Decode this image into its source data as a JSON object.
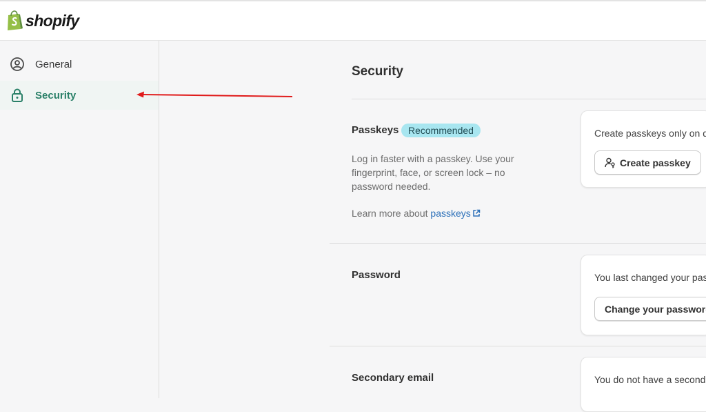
{
  "brand": {
    "name": "shopify"
  },
  "sidebar": {
    "items": [
      {
        "label": "General",
        "icon": "user-circle-icon",
        "active": false
      },
      {
        "label": "Security",
        "icon": "lock-icon",
        "active": true
      }
    ]
  },
  "main": {
    "title": "Security",
    "passkeys": {
      "title": "Passkeys",
      "badge": "Recommended",
      "description": "Log in faster with a passkey. Use your fingerprint, face, or screen lock – no password needed.",
      "learn_prefix": "Learn more about ",
      "learn_link": "passkeys",
      "card_text": "Create passkeys only on de",
      "button": "Create passkey"
    },
    "password": {
      "title": "Password",
      "card_text": "You last changed your pas",
      "button": "Change your password"
    },
    "secondary_email": {
      "title": "Secondary email",
      "card_text": "You do not have a seconda"
    }
  },
  "colors": {
    "accent": "#2a8068",
    "badge_bg": "#a8e6f0",
    "link": "#2b6fb8",
    "annotation_arrow": "#e01b1b"
  }
}
